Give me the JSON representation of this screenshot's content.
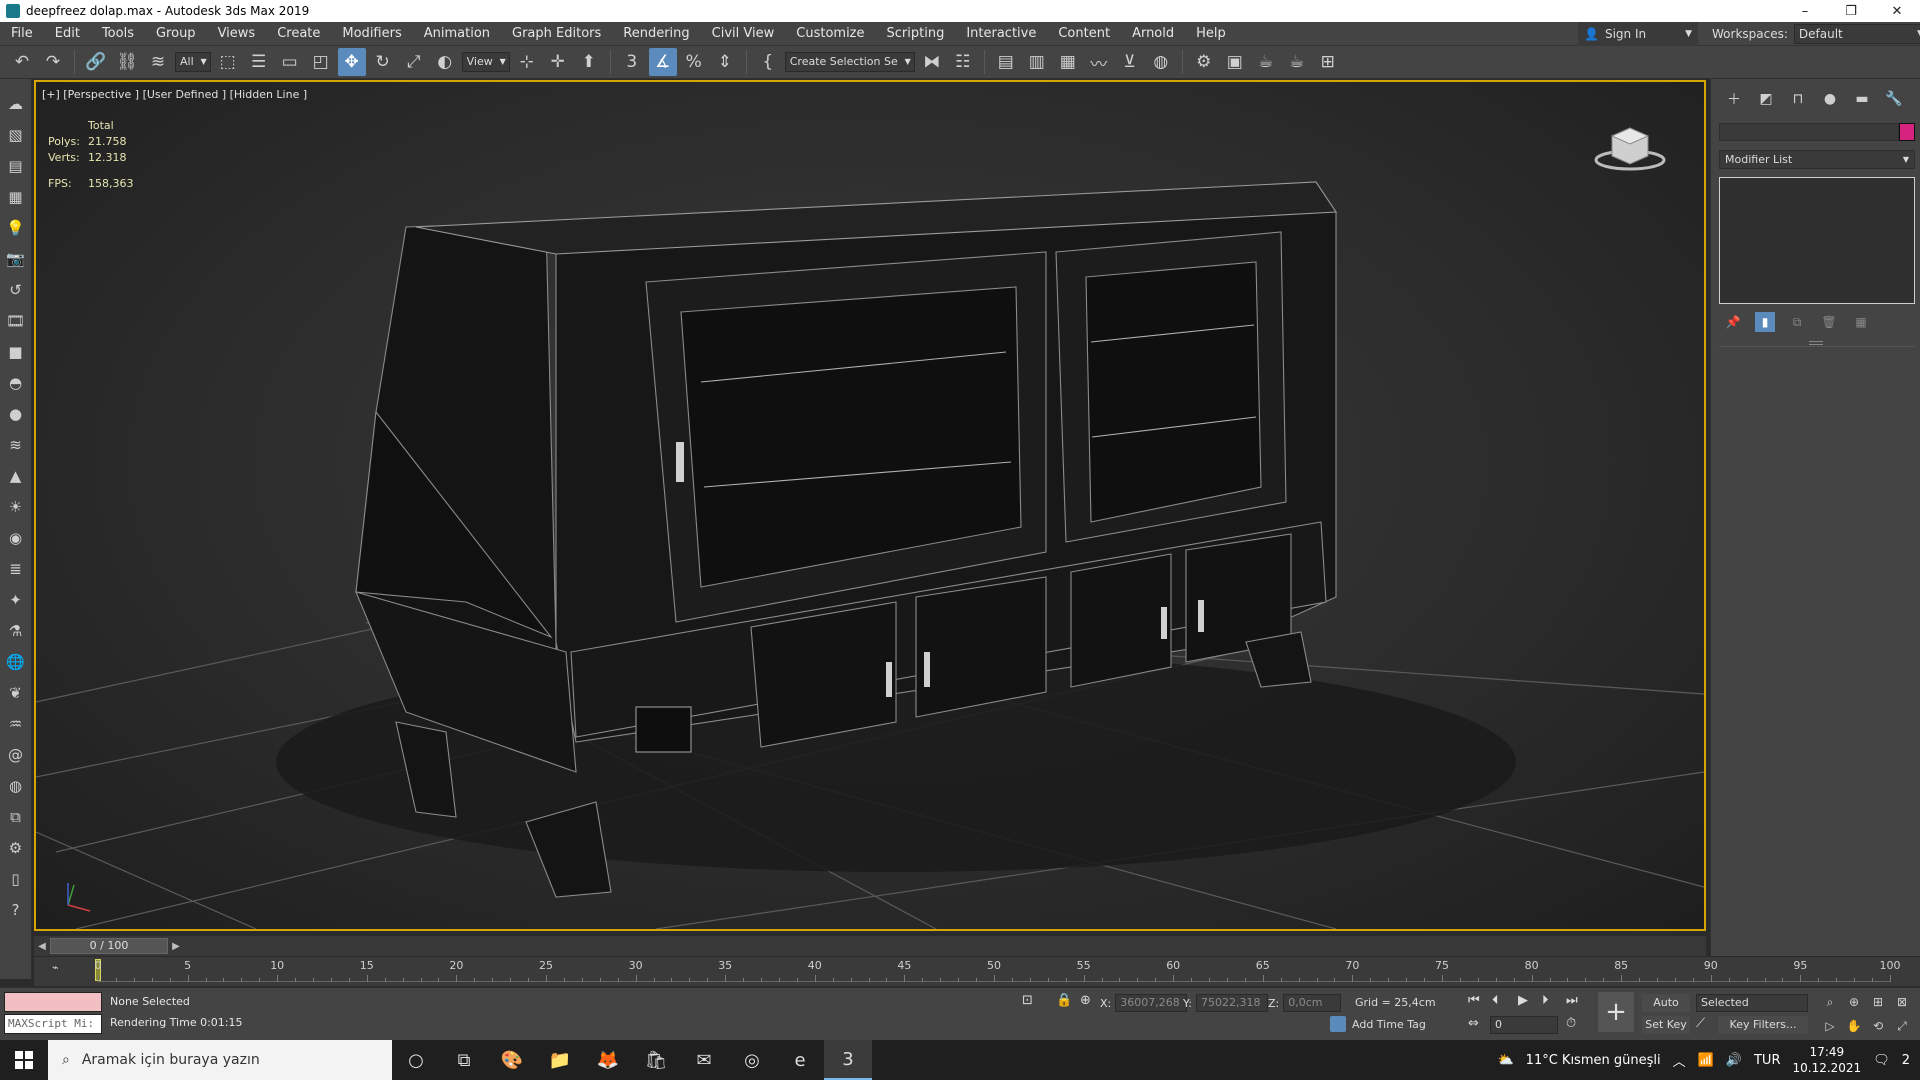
{
  "window": {
    "title": "deepfreez dolap.max - Autodesk 3ds Max 2019",
    "controls": [
      "–",
      "❐",
      "✕"
    ]
  },
  "menu": [
    "File",
    "Edit",
    "Tools",
    "Group",
    "Views",
    "Create",
    "Modifiers",
    "Animation",
    "Graph Editors",
    "Rendering",
    "Civil View",
    "Customize",
    "Scripting",
    "Interactive",
    "Content",
    "Arnold",
    "Help"
  ],
  "account": {
    "sign_in": "Sign In"
  },
  "workspaces": {
    "label": "Workspaces:",
    "value": "Default"
  },
  "toolbar": {
    "filter": "All",
    "ref_coord": "View",
    "selection_set": "Create Selection Se"
  },
  "viewport": {
    "label": "[+] [Perspective ] [User Defined ] [Hidden Line ]",
    "stats": {
      "total_label": "Total",
      "polys_label": "Polys:",
      "polys": "21.758",
      "verts_label": "Verts:",
      "verts": "12.318",
      "fps_label": "FPS:",
      "fps": "158,363"
    }
  },
  "command_panel": {
    "modifier_list": "Modifier List",
    "object_color": "#d6237f"
  },
  "timeline": {
    "slider": "0 / 100",
    "current": 0,
    "end": 100,
    "labels": [
      "0",
      "5",
      "10",
      "15",
      "20",
      "25",
      "30",
      "35",
      "40",
      "45",
      "50",
      "55",
      "60",
      "65",
      "70",
      "75",
      "80",
      "85",
      "90",
      "95",
      "100"
    ]
  },
  "status": {
    "maxscript": "MAXScript Mi:",
    "selection": "None Selected",
    "rendering_time": "Rendering Time  0:01:15",
    "x_label": "X:",
    "x": "36007,268",
    "y_label": "Y:",
    "y": "75022,318",
    "z_label": "Z:",
    "z": "0,0cm",
    "grid": "Grid = 25,4cm",
    "add_time_tag": "Add Time Tag",
    "frame": "0",
    "auto_key": "Auto Key",
    "set_key": "Set Key",
    "key_mode": "Selected",
    "key_filters": "Key Filters..."
  },
  "taskbar": {
    "search_placeholder": "Aramak için buraya yazın",
    "weather": "11°C  Kısmen güneşli",
    "language": "TUR",
    "time": "17:49",
    "date": "10.12.2021",
    "notifications": "2"
  }
}
